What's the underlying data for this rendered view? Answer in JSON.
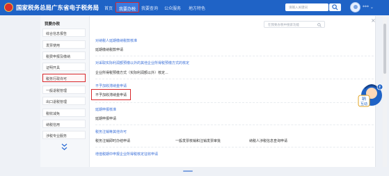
{
  "header": {
    "site_title": "国家税务总局广东省电子税务局",
    "nav": [
      {
        "label": "首页"
      },
      {
        "label": "我要办税",
        "active": true
      },
      {
        "label": "我要查询"
      },
      {
        "label": "公众服务"
      },
      {
        "label": "地方特色"
      }
    ],
    "search_placeholder": "请输入关键词",
    "user_name": "*** ⌄"
  },
  "sidebar": {
    "heading": "我要办税",
    "items": [
      {
        "label": "综合信息报告"
      },
      {
        "label": "发票使用"
      },
      {
        "label": "税费申报及缴纳"
      },
      {
        "label": "证明开具"
      },
      {
        "label": "税务行政许可",
        "active": true
      },
      {
        "label": "一般退税管理"
      },
      {
        "label": "出口退税管理"
      },
      {
        "label": "税收减免"
      },
      {
        "label": "纳税信用"
      },
      {
        "label": "涉税专业服务"
      }
    ]
  },
  "main": {
    "search_placeholder": "在我要办税中搜索功能",
    "groups": [
      {
        "title": "对纳税人延期缴纳税款核准",
        "links": [
          "延期缴纳税款申请"
        ]
      },
      {
        "title": "对采取实际利润额预缴以外的其他企业所得税预缴方式的核定",
        "links": [
          "企业所得税预缴方式（实际利润额以外）核定..."
        ]
      },
      {
        "title": "不予加收滞纳金申请",
        "links": [
          "不予加收滞纳金申请"
        ]
      },
      {
        "title": "延期申报核准",
        "links": [
          "延期申报申请"
        ]
      },
      {
        "title": "税务注销等其他许可",
        "links": [
          "税务注销即时办结申请",
          "一般发票核销和注销发票审批",
          "纳税人涉税信息查询申请"
        ]
      },
      {
        "title": "增值税期中申报企业所得税核定征收申请",
        "links": []
      }
    ]
  },
  "mascot": {
    "line1": "纳",
    "line2": "互动",
    "badge": "E"
  },
  "colors": {
    "brand_blue": "#1f63c6",
    "link_blue": "#3a6fd8",
    "highlight_red": "#d8282c"
  }
}
